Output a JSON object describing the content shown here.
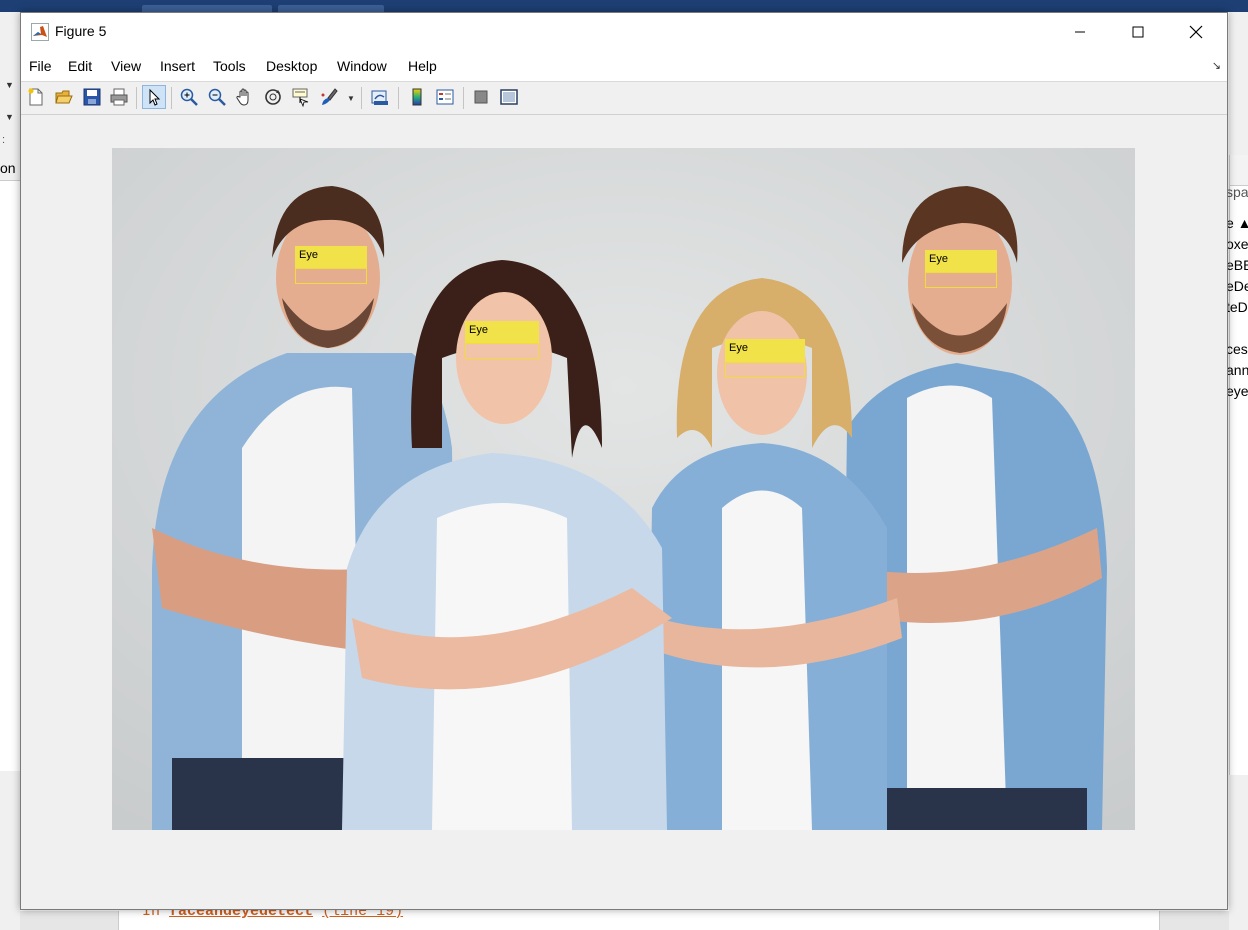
{
  "window": {
    "title": "Figure 5",
    "controls": {
      "minimize": "–",
      "maximize": "☐",
      "close": "✕"
    }
  },
  "menu": [
    "File",
    "Edit",
    "View",
    "Insert",
    "Tools",
    "Desktop",
    "Window",
    "Help"
  ],
  "toolbar": [
    "new-figure-icon",
    "open-file-icon",
    "save-icon",
    "print-icon",
    "edit-plot-pointer-icon",
    "zoom-in-icon",
    "zoom-out-icon",
    "pan-hand-icon",
    "rotate-3d-icon",
    "data-cursor-icon",
    "brush-icon",
    "link-plot-icon",
    "insert-colorbar-icon",
    "insert-legend-icon",
    "hide-plot-tools-icon",
    "show-plot-tools-icon"
  ],
  "detections": [
    {
      "label": "Eye",
      "person": 1
    },
    {
      "label": "Eye",
      "person": 2
    },
    {
      "label": "Eye",
      "person": 3
    },
    {
      "label": "Eye",
      "person": 4
    }
  ],
  "background": {
    "left_label": "on",
    "right_header": "spa",
    "right_lines": [
      "e ▲",
      "oxe",
      "eBE",
      "eDe",
      "teD",
      "",
      "ces",
      "ann",
      "eye"
    ],
    "command_line": {
      "prefix": "In ",
      "function": "faceandeyedetect",
      "location": "(line 19)"
    }
  },
  "colors": {
    "detection_fill": "#f2e24a",
    "detection_border": "#f2dc3c",
    "desktop_bar": "#1d3f73"
  }
}
